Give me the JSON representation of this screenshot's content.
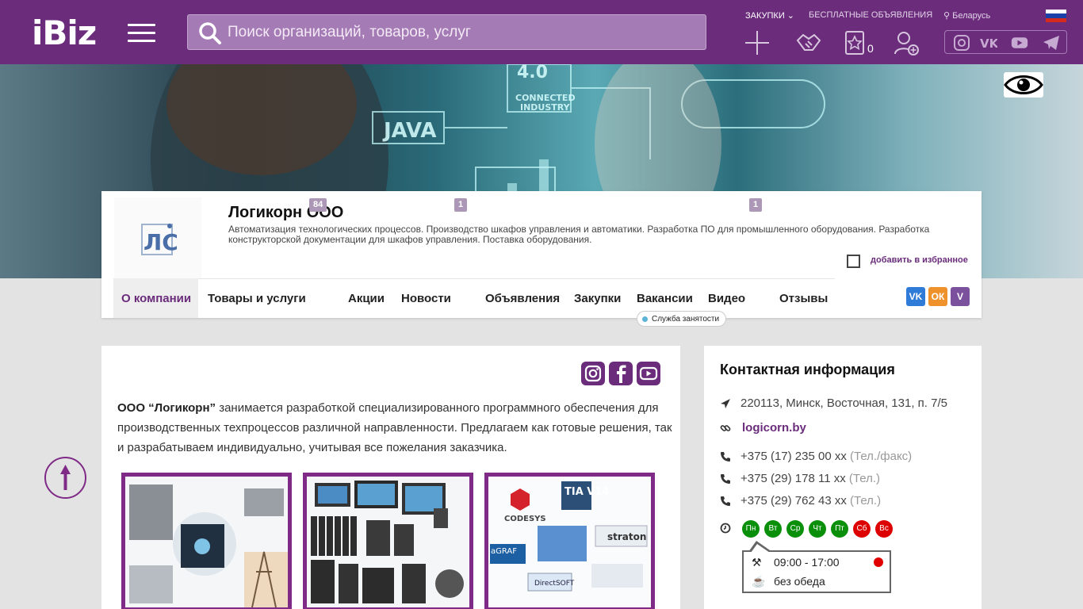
{
  "header": {
    "logo": "iBiz",
    "search_placeholder": "Поиск организаций, товаров, услуг",
    "links": {
      "purchases": "ЗАКУПКИ",
      "free_ads": "БЕСПЛАТНЫЕ ОБЪЯВЛЕНИЯ",
      "region": "Беларусь"
    },
    "favorites_count": "0",
    "socials": [
      "instagram-icon",
      "vk-icon",
      "youtube-icon",
      "telegram-icon"
    ]
  },
  "company": {
    "name": "Логикорн ООО",
    "description": "Автоматизация технологических процессов. Производство шкафов управления и автоматики. Разработка ПО для промышленного оборудования. Разработка конструкторской документации для шкафов управления. Поставка оборудования.",
    "add_favorite": "добавить в избранное",
    "logo_letters": "ЛС"
  },
  "tabs": [
    {
      "label": "О компании",
      "active": true
    },
    {
      "label": "Товары и услуги",
      "badge": "84"
    },
    {
      "label": "Акции"
    },
    {
      "label": "Новости",
      "badge": "1"
    },
    {
      "label": "Объявления"
    },
    {
      "label": "Закупки"
    },
    {
      "label": "Вакансии"
    },
    {
      "label": "Видео",
      "badge": "1"
    },
    {
      "label": "Отзывы"
    }
  ],
  "employment_tooltip": "Служба занятости",
  "share": {
    "vk": "VK",
    "ok": "ОК",
    "viber": "V"
  },
  "about": {
    "company_name": "ООО “Логикорн”",
    "text": " занимается разработкой специализированного программного обеспечения для производственных техпроцессов различной направленности. Предлагаем как готовые решения, так и разрабатываем индивидуально, учитывая все пожелания заказчика.",
    "thumbs": [
      {
        "label": ""
      },
      {
        "label": ""
      },
      {
        "labels": [
          "CODESYS",
          "TIA V14",
          "straton",
          "aGRAF",
          "DirectSOFT"
        ]
      }
    ]
  },
  "contacts": {
    "title": "Контактная информация",
    "address": "220113, Минск, Восточная, 131, п. 7/5",
    "site": "logicorn.by",
    "phones": [
      {
        "number": "+375 (17) 235 00 xx",
        "type": "(Тел./факс)"
      },
      {
        "number": "+375 (29) 178 11 xx",
        "type": "(Тел.)"
      },
      {
        "number": "+375 (29) 762 43 xx",
        "type": "(Тел.)"
      }
    ],
    "days": [
      {
        "label": "Пн",
        "open": true
      },
      {
        "label": "Вт",
        "open": true
      },
      {
        "label": "Ср",
        "open": true
      },
      {
        "label": "Чт",
        "open": true
      },
      {
        "label": "Пт",
        "open": true
      },
      {
        "label": "Сб",
        "open": false
      },
      {
        "label": "Вс",
        "open": false
      }
    ],
    "hours": "09:00 - 17:00",
    "lunch": "без обеда",
    "colors": {
      "open": "#0a8f0a",
      "closed": "#dd0000"
    }
  },
  "banner_text": [
    "JAVA",
    "4.0",
    "CONNECTED",
    "INDUSTRY"
  ]
}
